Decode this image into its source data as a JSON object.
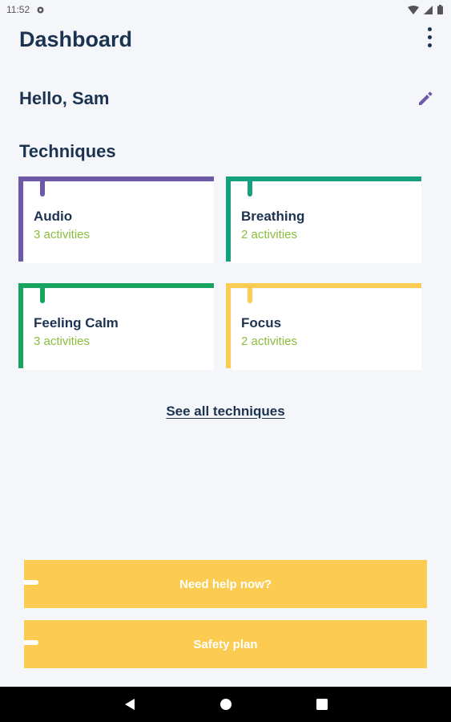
{
  "status_bar": {
    "time": "11:52",
    "icons": [
      "notification-icon",
      "wifi-icon",
      "signal-icon",
      "battery-icon"
    ]
  },
  "header": {
    "title": "Dashboard",
    "more_icon": "more-vertical-icon"
  },
  "greeting": {
    "text": "Hello, Sam",
    "edit_icon": "pencil-icon"
  },
  "techniques": {
    "title": "Techniques",
    "cards": [
      {
        "name": "Audio",
        "count": "3 activities",
        "color": "#6d59a5"
      },
      {
        "name": "Breathing",
        "count": "2 activities",
        "color": "#16a17d"
      },
      {
        "name": "Feeling Calm",
        "count": "3 activities",
        "color": "#17a45f"
      },
      {
        "name": "Focus",
        "count": "2 activities",
        "color": "#fccb52"
      }
    ],
    "see_all": "See all techniques"
  },
  "actions": {
    "need_help": "Need help now?",
    "safety_plan": "Safety plan",
    "color": "#fccb52"
  },
  "nav_bar": {
    "icons": [
      "back-icon",
      "home-icon",
      "recents-icon"
    ]
  },
  "colors": {
    "background": "#f4f6f9",
    "text": "#1b3351",
    "count": "#8bbd3f",
    "edit": "#6d59a5"
  }
}
